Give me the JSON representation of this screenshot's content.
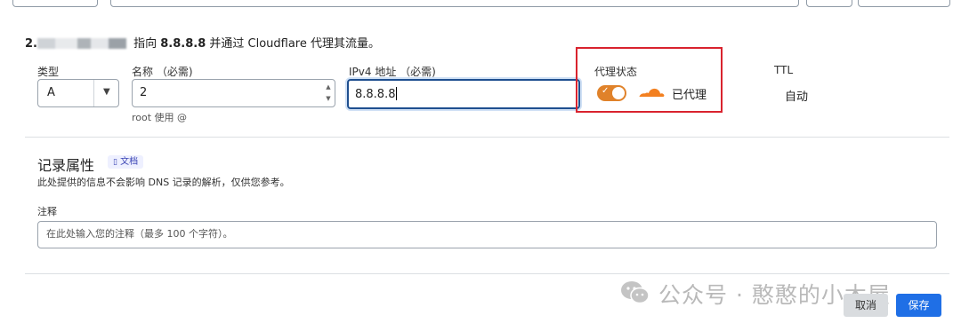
{
  "summary": {
    "prefix": "2.",
    "text_before": " 指向 ",
    "target": "8.8.8.8",
    "text_after": " 并通过 Cloudflare 代理其流量。"
  },
  "fields": {
    "type": {
      "label": "类型",
      "value": "A"
    },
    "name": {
      "label": "名称 （必需)",
      "value": "2",
      "helper": "root 使用 @"
    },
    "ipv4": {
      "label": "IPv4 地址 （必需)",
      "value": "8.8.8.8"
    },
    "proxy": {
      "label": "代理状态",
      "status": "已代理",
      "enabled": true,
      "toggle_color": "#e0822a",
      "cloud_color": "#f38020"
    },
    "ttl": {
      "label": "TTL",
      "value": "自动"
    }
  },
  "record_attributes": {
    "title": "记录属性",
    "docs_badge": "文档",
    "description": "此处提供的信息不会影响 DNS 记录的解析，仅供您参考。",
    "comment_label": "注释",
    "comment_placeholder": "在此处输入您的注释（最多 100 个字符）。"
  },
  "watermark": "公众号 · 憨憨的小木屋",
  "buttons": {
    "cancel": "取消",
    "save": "保存"
  },
  "colors": {
    "highlight_box": "#d9232e",
    "primary": "#1f6fe6"
  }
}
